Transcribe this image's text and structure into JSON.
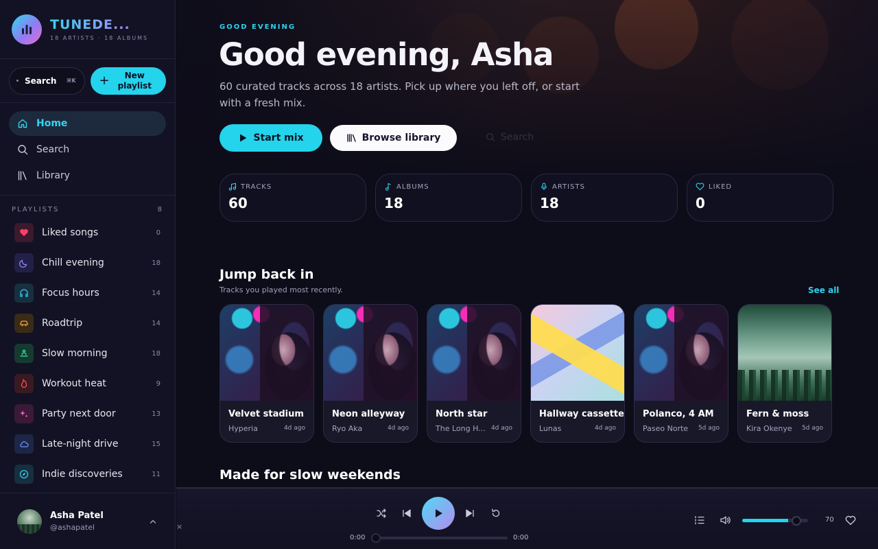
{
  "brand": {
    "name": "TUNEDE...",
    "subtitle": "18 ARTISTS · 18 ALBUMS"
  },
  "quick": {
    "search_label": "Search",
    "search_shortcut": "⌘K",
    "new_playlist_label": "New playlist"
  },
  "nav": [
    {
      "label": "Home",
      "icon": "home-icon",
      "active": true
    },
    {
      "label": "Search",
      "icon": "search-icon",
      "active": false
    },
    {
      "label": "Library",
      "icon": "library-icon",
      "active": false
    }
  ],
  "playlists": {
    "heading": "PLAYLISTS",
    "count": "8",
    "items": [
      {
        "label": "Liked songs",
        "count": "0",
        "icon": "heart-icon",
        "color": "#ff3b6b",
        "bg": "#3a1a2c"
      },
      {
        "label": "Chill evening",
        "count": "18",
        "icon": "moon-icon",
        "color": "#8f86f0",
        "bg": "#232047"
      },
      {
        "label": "Focus hours",
        "count": "14",
        "icon": "headphones-icon",
        "color": "#36c6ee",
        "bg": "#16303f"
      },
      {
        "label": "Roadtrip",
        "count": "14",
        "icon": "car-icon",
        "color": "#f1a437",
        "bg": "#3a2a18"
      },
      {
        "label": "Slow morning",
        "count": "18",
        "icon": "sunrise-icon",
        "color": "#39d9a4",
        "bg": "#163a30"
      },
      {
        "label": "Workout heat",
        "count": "9",
        "icon": "flame-icon",
        "color": "#ff4f4f",
        "bg": "#3a1a22"
      },
      {
        "label": "Party next door",
        "count": "13",
        "icon": "sparkles-icon",
        "color": "#f062c5",
        "bg": "#3a1a36"
      },
      {
        "label": "Late-night drive",
        "count": "15",
        "icon": "cloud-icon",
        "color": "#6f8df2",
        "bg": "#1c2748"
      },
      {
        "label": "Indie discoveries",
        "count": "11",
        "icon": "compass-icon",
        "color": "#36c6ee",
        "bg": "#16303f"
      }
    ]
  },
  "user": {
    "name": "Asha Patel",
    "handle": "@ashapatel"
  },
  "hero": {
    "eyebrow": "GOOD EVENING",
    "title": "Good evening, Asha",
    "description": "60 curated tracks across 18 artists. Pick up where you left off, or start with a fresh mix.",
    "start_label": "Start mix",
    "browse_label": "Browse library",
    "ghost_search": "Search"
  },
  "stats": [
    {
      "label": "TRACKS",
      "value": "60",
      "icon": "music-note-icon"
    },
    {
      "label": "ALBUMS",
      "value": "18",
      "icon": "single-note-icon"
    },
    {
      "label": "ARTISTS",
      "value": "18",
      "icon": "microphone-icon"
    },
    {
      "label": "LIKED",
      "value": "0",
      "icon": "heart-outline-icon"
    }
  ],
  "jump_back": {
    "title": "Jump back in",
    "subtitle": "Tracks you played most recently.",
    "see_all": "See all",
    "cards": [
      {
        "title": "Velvet stadium",
        "artist": "Hyperia",
        "when": "4d ago",
        "art": "portrait"
      },
      {
        "title": "Neon alleyway",
        "artist": "Ryo Aka",
        "when": "4d ago",
        "art": "portrait"
      },
      {
        "title": "North star",
        "artist": "The Long H...",
        "when": "4d ago",
        "art": "portrait"
      },
      {
        "title": "Hallway cassette",
        "artist": "Lunas",
        "when": "4d ago",
        "art": "cassette"
      },
      {
        "title": "Polanco, 4 AM",
        "artist": "Paseo Norte",
        "when": "5d ago",
        "art": "portrait"
      },
      {
        "title": "Fern & moss",
        "artist": "Kira Okenye",
        "when": "5d ago",
        "art": "forest"
      }
    ]
  },
  "next_section": {
    "title": "Made for slow weekends"
  },
  "player": {
    "elapsed": "0:00",
    "duration": "0:00",
    "volume": "70",
    "volume_fraction": 0.7,
    "close_label": "×"
  },
  "colors": {
    "accent": "#24d3ec",
    "background": "#0d0c19",
    "sidebar": "#121224"
  }
}
